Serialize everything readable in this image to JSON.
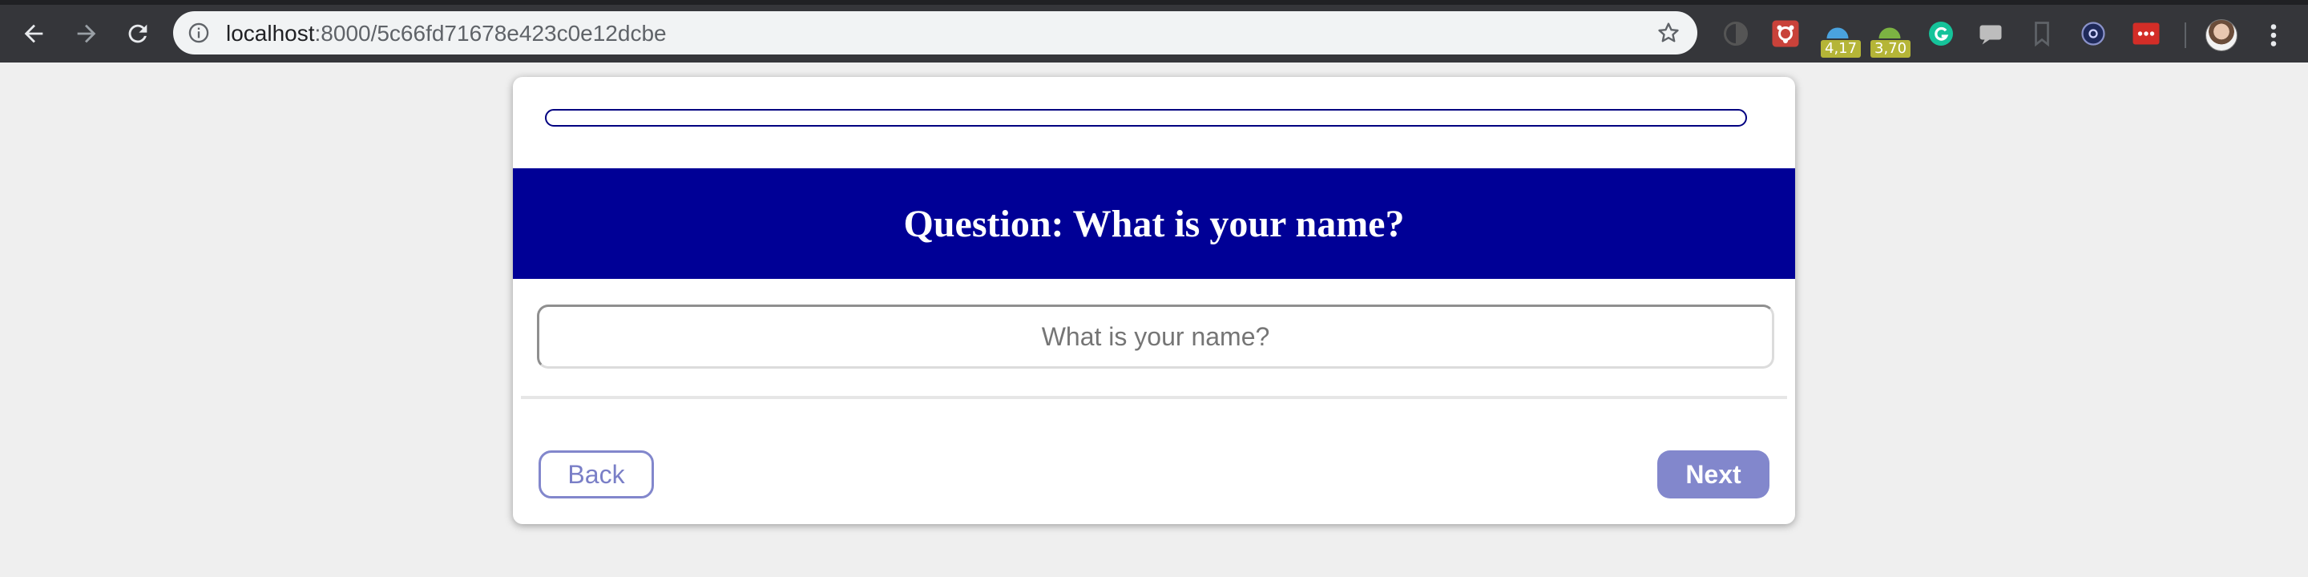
{
  "browser": {
    "url_host": "localhost",
    "url_path": ":8000/5c66fd71678e423c0e12dcbe",
    "extensions": [
      {
        "name": "dark-mode-extension-icon"
      },
      {
        "name": "pixel-extension-icon",
        "color": "#c9423a"
      },
      {
        "name": "weather-extension-icon",
        "badge": "4,17",
        "color": "#4aa3df"
      },
      {
        "name": "android-extension-icon",
        "badge": "3,70",
        "color": "#7cb342"
      },
      {
        "name": "grammarly-extension-icon",
        "color": "#15c39a"
      },
      {
        "name": "chat-extension-icon"
      },
      {
        "name": "bookmark-extension-icon"
      },
      {
        "name": "target-extension-icon"
      },
      {
        "name": "lastpass-extension-icon",
        "color": "#d32d27"
      }
    ]
  },
  "survey": {
    "progress_fraction": 0,
    "question_title": "Question: What is your name?",
    "input_placeholder": "What is your name?",
    "input_value": "",
    "back_label": "Back",
    "next_label": "Next"
  },
  "colors": {
    "header_bg": "#000096",
    "progress_border": "#010080",
    "button_accent": "#8287cc",
    "page_bg": "#efefef"
  }
}
